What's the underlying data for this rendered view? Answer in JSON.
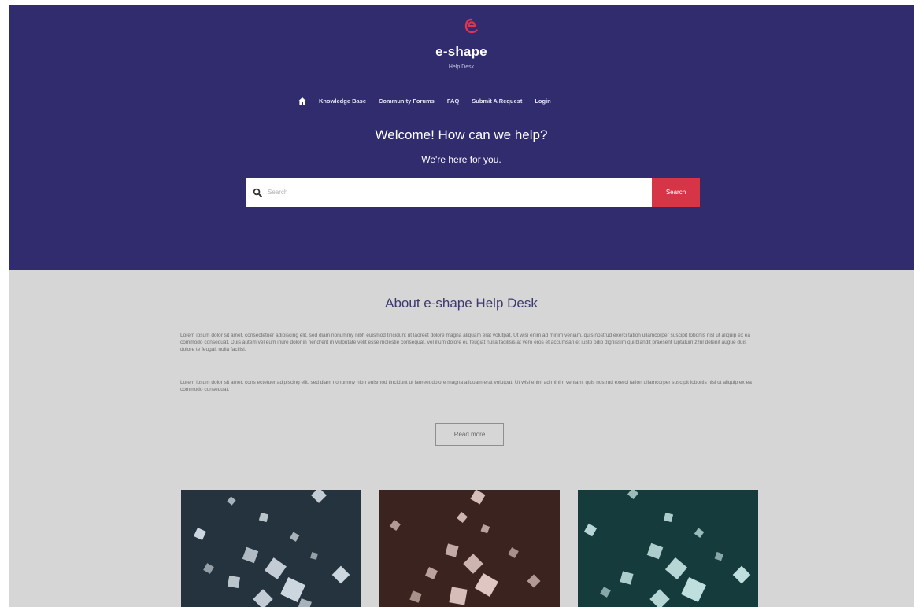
{
  "header": {
    "brand": "e-shape",
    "subtitle": "Help Desk",
    "logo_color": "#e0354e",
    "background": "#302c6e"
  },
  "nav": {
    "home_icon": "home-icon",
    "items": [
      "Knowledge Base",
      "Community Forums",
      "FAQ",
      "Submit A Request",
      "Login"
    ]
  },
  "hero": {
    "welcome": "Welcome! How can we help?",
    "tagline": "We're here for you."
  },
  "search": {
    "placeholder": "Search",
    "button_label": "Search",
    "button_color": "#d63447",
    "icon": "search-icon"
  },
  "about": {
    "title": "About e-shape Help Desk",
    "paragraphs": [
      "Lorem ipsum dolor sit amet, consectetuer adipiscing elit, sed diam nonummy nibh euismod tincidunt ut laoreet dolore magna aliquam erat volutpat. Ut wisi enim ad minim veniam, quis nostrud exerci tation ullamcorper suscipit lobortis nisl ut aliquip ex ea commodo consequat. Duis autem vel eum iriure dolor in hendrerit in vulputate velit esse molestie consequat, vel illum dolore eu feugiat nulla facilisis at vero eros et accumsan et iusto odio dignissim qui blandit praesent luptatum zzril delenit augue duis dolore te feugait nulla facilisi.",
      "Lorem ipsum dolor sit amet, cons ectetuer adipiscing elit, sed diam nonummy nibh euismod tincidunt ut laoreet dolore magna aliquam erat volutpat. Ut wisi enim ad minim veniam, quis nostrud exerci tation ullamcorper suscipit lobortis nisl ut aliquip ex ea commodo consequat."
    ],
    "read_more": "Read more"
  },
  "cards": [
    {
      "tint": "#2e3f4c",
      "glow": "#dfe8ef"
    },
    {
      "tint": "#4a2e2b",
      "glow": "#f2d8d4"
    },
    {
      "tint": "#1e4a4c",
      "glow": "#d2f2f0"
    }
  ]
}
